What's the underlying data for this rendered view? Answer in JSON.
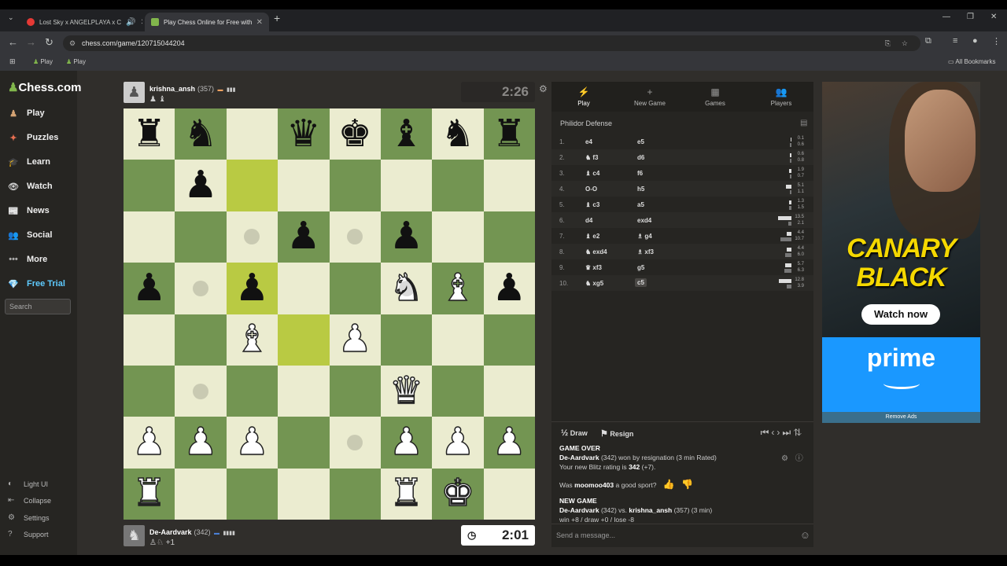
{
  "browser": {
    "tabs": [
      {
        "title": "Lost Sky x ANGELPLAYA x C",
        "active": false
      },
      {
        "title": "Play Chess Online for Free with",
        "active": true
      }
    ],
    "new_tab": "+",
    "url": "chess.com/game/120715044204",
    "bookmarks": [
      {
        "label": "Play"
      },
      {
        "label": "Play"
      }
    ],
    "all_bookmarks": "All Bookmarks"
  },
  "sidebar": {
    "logo": "Chess.com",
    "items": [
      {
        "label": "Play",
        "color": "#d4a373"
      },
      {
        "label": "Puzzles",
        "color": "#e76f51"
      },
      {
        "label": "Learn",
        "color": "#2a9df4"
      },
      {
        "label": "Watch",
        "color": "#ccc"
      },
      {
        "label": "News",
        "color": "#e63946"
      },
      {
        "label": "Social",
        "color": "#f4a261"
      },
      {
        "label": "More",
        "color": "#aaa"
      },
      {
        "label": "Free Trial",
        "color": "#5ecbff"
      }
    ],
    "search_placeholder": "Search",
    "bottom": [
      {
        "label": "Light UI"
      },
      {
        "label": "Collapse"
      },
      {
        "label": "Settings"
      },
      {
        "label": "Support"
      }
    ]
  },
  "top_player": {
    "name": "krishna_ansh",
    "rating": "(357)",
    "captured": "♟ ♝",
    "clock": "2:26"
  },
  "bottom_player": {
    "name": "De-Aardvark",
    "rating": "(342)",
    "captured": "♙♘ +1",
    "clock": "2:01"
  },
  "board": [
    [
      "bR",
      "bN",
      "",
      "bQ",
      "bK",
      "bB",
      "bN",
      "bR"
    ],
    [
      "",
      "bP",
      "",
      "",
      "",
      "",
      "",
      ""
    ],
    [
      "",
      "",
      "",
      "bP",
      "",
      "bP",
      "",
      ""
    ],
    [
      "bP",
      "",
      "bP",
      "",
      "",
      "wN",
      "wB",
      "bP"
    ],
    [
      "",
      "",
      "wB",
      "",
      "wP",
      "",
      "",
      ""
    ],
    [
      "",
      "",
      "",
      "",
      "",
      "wQ",
      "",
      ""
    ],
    [
      "wP",
      "wP",
      "wP",
      "",
      "",
      "wP",
      "wP",
      "wP"
    ],
    [
      "wR",
      "",
      "",
      "",
      "",
      "wR",
      "wK",
      ""
    ]
  ],
  "panel": {
    "tabs": [
      {
        "label": "Play",
        "icon": "⚡"
      },
      {
        "label": "New Game",
        "icon": "+"
      },
      {
        "label": "Games",
        "icon": "▦"
      },
      {
        "label": "Players",
        "icon": "👥"
      }
    ],
    "opening": "Philidor Defense",
    "moves": [
      {
        "n": "1.",
        "w": "e4",
        "b": "e5",
        "wt": "0.1",
        "bt": "0.6"
      },
      {
        "n": "2.",
        "w": "♞ f3",
        "b": "d6",
        "wt": "0.6",
        "bt": "0.8"
      },
      {
        "n": "3.",
        "w": "♝ c4",
        "b": "f6",
        "wt": "1.9",
        "bt": "0.7"
      },
      {
        "n": "4.",
        "w": "O-O",
        "b": "h5",
        "wt": "5.1",
        "bt": "1.1"
      },
      {
        "n": "5.",
        "w": "♝ c3",
        "b": "a5",
        "wt": "1.3",
        "bt": "1.5"
      },
      {
        "n": "6.",
        "w": "d4",
        "b": "exd4",
        "wt": "13.5",
        "bt": "2.1"
      },
      {
        "n": "7.",
        "w": "♝ e2",
        "b": "♗ g4",
        "wt": "4.4",
        "bt": "10.7"
      },
      {
        "n": "8.",
        "w": "♞ exd4",
        "b": "♗ xf3",
        "wt": "4.4",
        "bt": "6.0"
      },
      {
        "n": "9.",
        "w": "♛ xf3",
        "b": "g5",
        "wt": "5.7",
        "bt": "6.3"
      },
      {
        "n": "10.",
        "w": "♞ xg5",
        "b": "c5",
        "wt": "12.8",
        "bt": "3.9"
      }
    ],
    "draw": "Draw",
    "draw_icon": "½",
    "resign": "Resign",
    "game_over": {
      "title": "GAME OVER",
      "winner": "De-Aardvark",
      "result_line": "(342) won by resignation (3 min Rated)",
      "rating_prefix": "Your new Blitz rating is",
      "rating_value": "342",
      "rating_delta": "(+7).",
      "sport_prefix": "Was",
      "sport_name": "moomoo403",
      "sport_suffix": "a good sport?",
      "new_game_title": "NEW GAME",
      "ng_p1": "De-Aardvark",
      "ng_mid": "(342) vs.",
      "ng_p2": "krishna_ansh",
      "ng_tail": "(357) (3 min)",
      "stats": "win +8 / draw +0 / lose -8"
    },
    "message_placeholder": "Send a message..."
  },
  "ad": {
    "line1": "CANARY",
    "line2": "BLACK",
    "watch": "Watch now",
    "brand": "prime",
    "remove": "Remove Ads"
  }
}
